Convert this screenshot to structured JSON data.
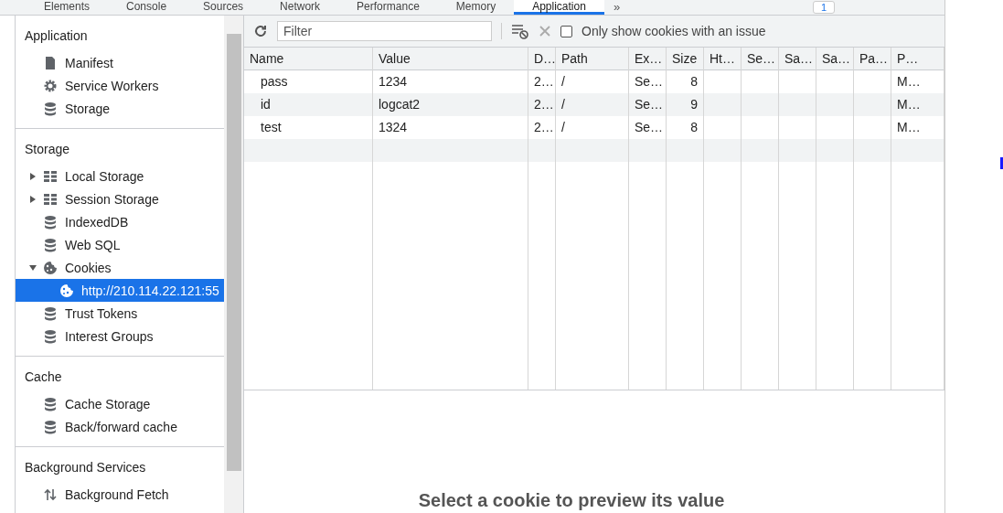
{
  "top_tabs": [
    {
      "label": "Elements",
      "selected": false
    },
    {
      "label": "Console",
      "selected": false
    },
    {
      "label": "Sources",
      "selected": false
    },
    {
      "label": "Network",
      "selected": false
    },
    {
      "label": "Performance",
      "selected": false
    },
    {
      "label": "Memory",
      "selected": false
    },
    {
      "label": "Application",
      "selected": true
    }
  ],
  "more_tabs": "»",
  "issues_badge": "1",
  "sidebar": [
    {
      "title": "Application",
      "items": [
        {
          "label": "Manifest",
          "kind": "file"
        },
        {
          "label": "Service Workers",
          "kind": "gear"
        },
        {
          "label": "Storage",
          "kind": "database"
        }
      ]
    },
    {
      "title": "Storage",
      "items": [
        {
          "label": "Local Storage",
          "kind": "grid",
          "expanded": false
        },
        {
          "label": "Session Storage",
          "kind": "grid",
          "expanded": false
        },
        {
          "label": "IndexedDB",
          "kind": "database"
        },
        {
          "label": "Web SQL",
          "kind": "database"
        },
        {
          "label": "Cookies",
          "kind": "cookie",
          "expanded": true,
          "children": [
            {
              "label": "http://210.114.22.121:55",
              "kind": "cookie",
              "selected": true
            }
          ]
        },
        {
          "label": "Trust Tokens",
          "kind": "database"
        },
        {
          "label": "Interest Groups",
          "kind": "database"
        }
      ]
    },
    {
      "title": "Cache",
      "items": [
        {
          "label": "Cache Storage",
          "kind": "database"
        },
        {
          "label": "Back/forward cache",
          "kind": "database"
        }
      ]
    },
    {
      "title": "Background Services",
      "items": [
        {
          "label": "Background Fetch",
          "kind": "updown"
        }
      ]
    }
  ],
  "toolbar": {
    "filter_placeholder": "Filter",
    "issue_only": {
      "label": "Only show cookies with an issue",
      "checked": false
    }
  },
  "table": {
    "columns": [
      "Name",
      "Value",
      "D…",
      "Path",
      "Ex…",
      "Size",
      "Ht…",
      "Se…",
      "Sa…",
      "Sa…",
      "Pa…",
      "P…"
    ],
    "rows": [
      [
        "pass",
        "1234",
        "2…",
        "/",
        "Se…",
        "8",
        "",
        "",
        "",
        "",
        "",
        "M…"
      ],
      [
        "id",
        "logcat2",
        "2…",
        "/",
        "Se…",
        "9",
        "",
        "",
        "",
        "",
        "",
        "M…"
      ],
      [
        "test",
        "1324",
        "2…",
        "/",
        "Se…",
        "8",
        "",
        "",
        "",
        "",
        "",
        "M…"
      ]
    ]
  },
  "preview": "Select a cookie to preview its value"
}
